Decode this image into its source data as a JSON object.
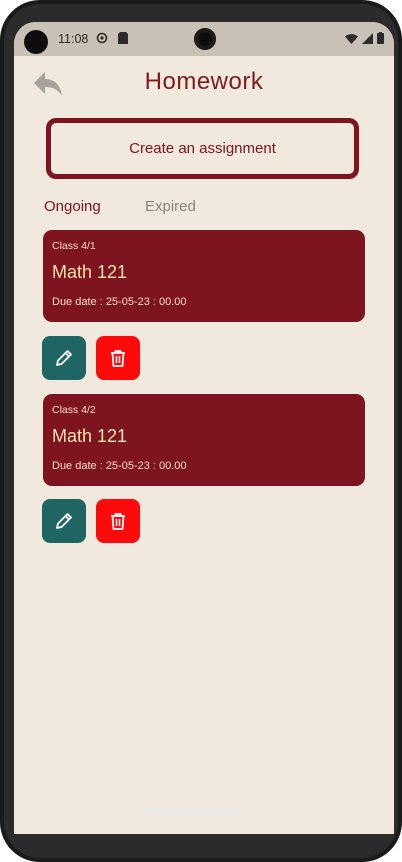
{
  "status_bar": {
    "time": "11:08"
  },
  "header": {
    "title": "Homework"
  },
  "create_button": {
    "label": "Create an assignment"
  },
  "tabs": [
    {
      "label": "Ongoing",
      "active": true
    },
    {
      "label": "Expired",
      "active": false
    }
  ],
  "assignments": [
    {
      "class_label": "Class 4/1",
      "subject": "Math 121",
      "due": "Due date : 25-05-23 : 00.00"
    },
    {
      "class_label": "Class 4/2",
      "subject": "Math 121",
      "due": "Due date : 25-05-23 : 00.00"
    }
  ],
  "colors": {
    "background": "#f1e8de",
    "accent": "#7e1420",
    "edit": "#1f6564",
    "delete": "#ff0a0a"
  },
  "icons": {
    "back": "back-arrow-icon",
    "edit": "pencil-icon",
    "delete": "trash-icon"
  }
}
